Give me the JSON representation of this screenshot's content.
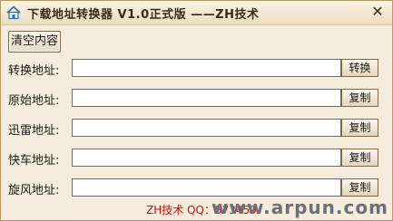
{
  "window": {
    "title": "下载地址转换器 V1.0正式版 ——ZH技术",
    "close_glyph": "✕",
    "app_icon": "home-icon"
  },
  "toolbar": {
    "clear_label": "清空内容"
  },
  "rows": [
    {
      "label": "转换地址:",
      "value": "",
      "button": "转换"
    },
    {
      "label": "原始地址:",
      "value": "",
      "button": "复制"
    },
    {
      "label": "迅雷地址:",
      "value": "",
      "button": "复制"
    },
    {
      "label": "快车地址:",
      "value": "",
      "button": "复制"
    },
    {
      "label": "旋风地址:",
      "value": "",
      "button": "复制"
    }
  ],
  "footer": {
    "credit": "ZH技术 QQ：573459",
    "watermark": "www.arpun.com"
  },
  "colors": {
    "window_bg": "#f5ecdb",
    "credit_text": "#d01010",
    "watermark_text": "#6c6f75"
  }
}
